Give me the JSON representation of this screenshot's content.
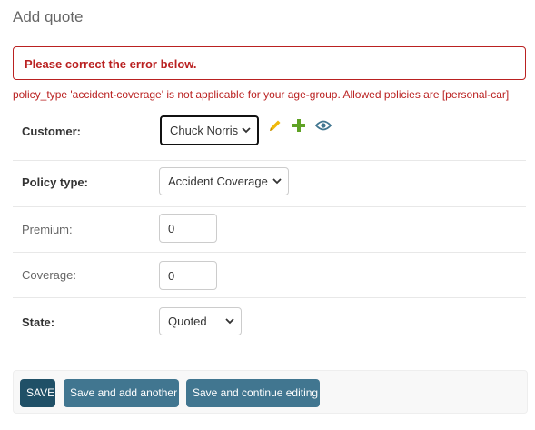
{
  "page": {
    "title": "Add quote"
  },
  "errors": {
    "summary": "Please correct the error below.",
    "field_error": "policy_type 'accident-coverage' is not applicable for your age-group. Allowed policies are [personal-car]"
  },
  "fields": {
    "customer": {
      "label": "Customer:",
      "value": "Chuck Norris",
      "actions": [
        "pencil-icon",
        "plus-icon",
        "eye-icon"
      ]
    },
    "policy_type": {
      "label": "Policy type:",
      "value": "Accident Coverage"
    },
    "premium": {
      "label": "Premium:",
      "value": "0"
    },
    "coverage": {
      "label": "Coverage:",
      "value": "0"
    },
    "state": {
      "label": "State:",
      "value": "Quoted"
    }
  },
  "submit": {
    "save": "SAVE",
    "save_add_another": "Save and add another",
    "save_continue": "Save and continue editing"
  },
  "colors": {
    "error": "#ba2121",
    "pencil": "#efb80b",
    "plus": "#5fa225",
    "eye": "#417690",
    "button_default": "#205067",
    "button_secondary": "#417690"
  }
}
